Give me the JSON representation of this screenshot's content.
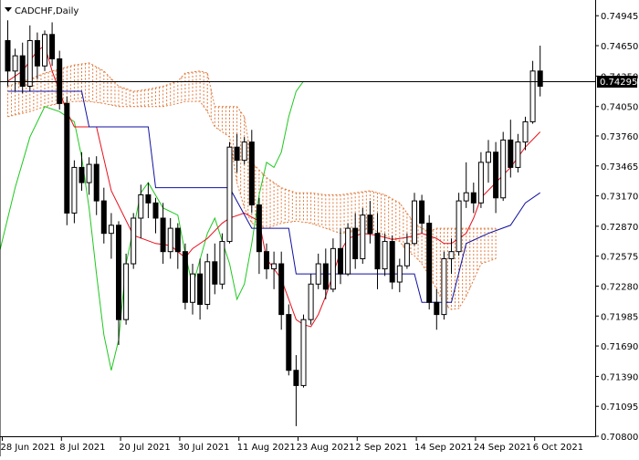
{
  "window": {
    "symbol_title": "CADCHF,Daily"
  },
  "price_box": {
    "label": "0.74295"
  },
  "colors": {
    "background": "#ffffff",
    "candle": "#000000",
    "tenkan": "#e8101b",
    "kijun": "#1010a0",
    "chikou": "#1ec81e",
    "kumo": "#e07a3c",
    "price_line": "#000000"
  },
  "chart_data": {
    "type": "candlestick",
    "title": "CADCHF,Daily",
    "indicator": "Ichimoku Kinko Hyo",
    "ylim": [
      0.708,
      0.751
    ],
    "y_ticks": [
      "0.74945",
      "0.74650",
      "0.74350",
      "0.74050",
      "0.73760",
      "0.73465",
      "0.73170",
      "0.72870",
      "0.72575",
      "0.72280",
      "0.71985",
      "0.71690",
      "0.71390",
      "0.71095",
      "0.70800"
    ],
    "x_ticks": [
      "28 Jun 2021",
      "8 Jul 2021",
      "20 Jul 2021",
      "30 Jul 2021",
      "11 Aug 2021",
      "23 Aug 2021",
      "2 Sep 2021",
      "14 Sep 2021",
      "24 Sep 2021",
      "6 Oct 2021"
    ],
    "x_tick_index": [
      0,
      8,
      16,
      24,
      32,
      40,
      48,
      56,
      64,
      72
    ],
    "current_price": 0.74295,
    "grid": false,
    "candles": [
      [
        0.747,
        0.749,
        0.7425,
        0.744
      ],
      [
        0.744,
        0.7462,
        0.742,
        0.7455
      ],
      [
        0.7455,
        0.7468,
        0.7418,
        0.7425
      ],
      [
        0.7425,
        0.7485,
        0.742,
        0.747
      ],
      [
        0.747,
        0.7478,
        0.7432,
        0.7445
      ],
      [
        0.7445,
        0.748,
        0.744,
        0.7476
      ],
      [
        0.7476,
        0.7488,
        0.7445,
        0.7452
      ],
      [
        0.7452,
        0.746,
        0.7402,
        0.7408
      ],
      [
        0.7408,
        0.7415,
        0.7288,
        0.73
      ],
      [
        0.73,
        0.7352,
        0.729,
        0.7345
      ],
      [
        0.7345,
        0.736,
        0.7322,
        0.733
      ],
      [
        0.733,
        0.7355,
        0.7318,
        0.7348
      ],
      [
        0.7348,
        0.7356,
        0.7298,
        0.7312
      ],
      [
        0.7312,
        0.7325,
        0.727,
        0.728
      ],
      [
        0.728,
        0.73,
        0.7255,
        0.7288
      ],
      [
        0.7288,
        0.7292,
        0.717,
        0.7195
      ],
      [
        0.7195,
        0.726,
        0.719,
        0.725
      ],
      [
        0.725,
        0.73,
        0.7245,
        0.7295
      ],
      [
        0.7295,
        0.7328,
        0.7275,
        0.7318
      ],
      [
        0.7318,
        0.733,
        0.7295,
        0.731
      ],
      [
        0.731,
        0.7315,
        0.728,
        0.7295
      ],
      [
        0.7295,
        0.731,
        0.725,
        0.7262
      ],
      [
        0.7262,
        0.7295,
        0.7255,
        0.7285
      ],
      [
        0.7285,
        0.729,
        0.7245,
        0.7262
      ],
      [
        0.7262,
        0.727,
        0.7205,
        0.7212
      ],
      [
        0.7212,
        0.725,
        0.72,
        0.724
      ],
      [
        0.724,
        0.7255,
        0.7195,
        0.721
      ],
      [
        0.721,
        0.726,
        0.7205,
        0.7252
      ],
      [
        0.7252,
        0.727,
        0.722,
        0.723
      ],
      [
        0.723,
        0.728,
        0.7225,
        0.7272
      ],
      [
        0.7272,
        0.737,
        0.727,
        0.7365
      ],
      [
        0.7365,
        0.7378,
        0.734,
        0.7352
      ],
      [
        0.7352,
        0.7375,
        0.7348,
        0.737
      ],
      [
        0.737,
        0.7382,
        0.73,
        0.7308
      ],
      [
        0.7308,
        0.7315,
        0.724,
        0.7262
      ],
      [
        0.7262,
        0.727,
        0.7235,
        0.7245
      ],
      [
        0.7245,
        0.7262,
        0.7225,
        0.725
      ],
      [
        0.725,
        0.7262,
        0.7185,
        0.72
      ],
      [
        0.72,
        0.721,
        0.714,
        0.7145
      ],
      [
        0.7145,
        0.716,
        0.709,
        0.713
      ],
      [
        0.713,
        0.72,
        0.7128,
        0.7195
      ],
      [
        0.7195,
        0.724,
        0.719,
        0.723
      ],
      [
        0.723,
        0.726,
        0.7225,
        0.725
      ],
      [
        0.725,
        0.7265,
        0.7215,
        0.7225
      ],
      [
        0.7225,
        0.7275,
        0.7222,
        0.7265
      ],
      [
        0.7265,
        0.7285,
        0.723,
        0.724
      ],
      [
        0.724,
        0.729,
        0.7238,
        0.7285
      ],
      [
        0.7285,
        0.73,
        0.7245,
        0.7255
      ],
      [
        0.7255,
        0.7305,
        0.725,
        0.7298
      ],
      [
        0.7298,
        0.7312,
        0.727,
        0.728
      ],
      [
        0.728,
        0.73,
        0.7225,
        0.7245
      ],
      [
        0.7245,
        0.728,
        0.7238,
        0.7272
      ],
      [
        0.7272,
        0.7278,
        0.7225,
        0.7232
      ],
      [
        0.7232,
        0.7255,
        0.7222,
        0.7248
      ],
      [
        0.7248,
        0.728,
        0.7245,
        0.727
      ],
      [
        0.727,
        0.732,
        0.7268,
        0.7312
      ],
      [
        0.7312,
        0.7318,
        0.728,
        0.729
      ],
      [
        0.729,
        0.7298,
        0.7205,
        0.7212
      ],
      [
        0.7212,
        0.7225,
        0.7185,
        0.72
      ],
      [
        0.72,
        0.7262,
        0.7195,
        0.7255
      ],
      [
        0.7255,
        0.7275,
        0.724,
        0.7262
      ],
      [
        0.7262,
        0.732,
        0.7258,
        0.7312
      ],
      [
        0.7312,
        0.735,
        0.7305,
        0.732
      ],
      [
        0.732,
        0.733,
        0.73,
        0.731
      ],
      [
        0.731,
        0.736,
        0.7305,
        0.735
      ],
      [
        0.735,
        0.7372,
        0.733,
        0.736
      ],
      [
        0.736,
        0.737,
        0.73,
        0.7315
      ],
      [
        0.7315,
        0.738,
        0.7312,
        0.7372
      ],
      [
        0.7372,
        0.7392,
        0.7335,
        0.7345
      ],
      [
        0.7345,
        0.7378,
        0.734,
        0.737
      ],
      [
        0.737,
        0.7395,
        0.7362,
        0.739
      ],
      [
        0.739,
        0.745,
        0.7388,
        0.744
      ],
      [
        0.744,
        0.7465,
        0.7415,
        0.7425
      ]
    ],
    "tenkan": [
      [
        0,
        0.743
      ],
      [
        2,
        0.744
      ],
      [
        4,
        0.746
      ],
      [
        5,
        0.7465
      ],
      [
        6,
        0.744
      ],
      [
        8,
        0.74
      ],
      [
        9,
        0.7385
      ],
      [
        12,
        0.7385
      ],
      [
        14,
        0.7322
      ],
      [
        17,
        0.7278
      ],
      [
        20,
        0.727
      ],
      [
        22,
        0.7268
      ],
      [
        23,
        0.7262
      ],
      [
        24,
        0.7256
      ],
      [
        25,
        0.7265
      ],
      [
        27,
        0.7275
      ],
      [
        29,
        0.729
      ],
      [
        30,
        0.7295
      ],
      [
        32,
        0.73
      ],
      [
        34,
        0.7292
      ],
      [
        35,
        0.7255
      ],
      [
        37,
        0.7235
      ],
      [
        38,
        0.7215
      ],
      [
        39,
        0.7195
      ],
      [
        40,
        0.719
      ],
      [
        41,
        0.7188
      ],
      [
        42,
        0.72
      ],
      [
        43,
        0.7218
      ],
      [
        44,
        0.724
      ],
      [
        45,
        0.7262
      ],
      [
        46,
        0.7275
      ],
      [
        48,
        0.728
      ],
      [
        50,
        0.7278
      ],
      [
        52,
        0.7274
      ],
      [
        54,
        0.7276
      ],
      [
        56,
        0.728
      ],
      [
        58,
        0.7275
      ],
      [
        59,
        0.727
      ],
      [
        60,
        0.727
      ],
      [
        62,
        0.728
      ],
      [
        63,
        0.7295
      ],
      [
        64,
        0.7315
      ],
      [
        66,
        0.733
      ],
      [
        68,
        0.7345
      ],
      [
        70,
        0.7365
      ],
      [
        72,
        0.738
      ]
    ],
    "kijun": [
      [
        0,
        0.742
      ],
      [
        10,
        0.742
      ],
      [
        11,
        0.7385
      ],
      [
        19,
        0.7385
      ],
      [
        20,
        0.7325
      ],
      [
        30,
        0.7325
      ],
      [
        33,
        0.7285
      ],
      [
        38,
        0.7285
      ],
      [
        39,
        0.724
      ],
      [
        55,
        0.724
      ],
      [
        56,
        0.7212
      ],
      [
        60,
        0.7212
      ],
      [
        62,
        0.727
      ],
      [
        65,
        0.728
      ],
      [
        68,
        0.7288
      ],
      [
        70,
        0.731
      ],
      [
        72,
        0.732
      ]
    ],
    "chikou": [
      [
        -3,
        0.7218
      ],
      [
        -1,
        0.7265
      ],
      [
        1,
        0.7325
      ],
      [
        3,
        0.7375
      ],
      [
        5,
        0.7405
      ],
      [
        7,
        0.74
      ],
      [
        9,
        0.739
      ],
      [
        10,
        0.7355
      ],
      [
        11,
        0.7305
      ],
      [
        12,
        0.724
      ],
      [
        13,
        0.718
      ],
      [
        14,
        0.7145
      ],
      [
        15,
        0.7175
      ],
      [
        16,
        0.725
      ],
      [
        18,
        0.732
      ],
      [
        19,
        0.733
      ],
      [
        21,
        0.7305
      ],
      [
        23,
        0.7298
      ],
      [
        24,
        0.726
      ],
      [
        25,
        0.7228
      ],
      [
        27,
        0.728
      ],
      [
        28,
        0.7295
      ],
      [
        30,
        0.725
      ],
      [
        31,
        0.7215
      ],
      [
        32,
        0.723
      ],
      [
        33,
        0.727
      ],
      [
        34,
        0.7318
      ],
      [
        35,
        0.735
      ],
      [
        36,
        0.7345
      ],
      [
        37,
        0.736
      ],
      [
        38,
        0.7395
      ],
      [
        39,
        0.742
      ],
      [
        40,
        0.743
      ]
    ],
    "kumo": [
      [
        0,
        0.7425,
        0.7395
      ],
      [
        3,
        0.7432,
        0.74
      ],
      [
        5,
        0.7438,
        0.7405
      ],
      [
        7,
        0.7442,
        0.7408
      ],
      [
        9,
        0.7446,
        0.741
      ],
      [
        11,
        0.7448,
        0.741
      ],
      [
        13,
        0.744,
        0.7408
      ],
      [
        15,
        0.7425,
        0.7405
      ],
      [
        17,
        0.742,
        0.7405
      ],
      [
        19,
        0.7422,
        0.7405
      ],
      [
        21,
        0.7425,
        0.7405
      ],
      [
        23,
        0.743,
        0.7408
      ],
      [
        24,
        0.7438,
        0.741
      ],
      [
        26,
        0.744,
        0.741
      ],
      [
        27,
        0.7438,
        0.74
      ],
      [
        28,
        0.7405,
        0.7385
      ],
      [
        30,
        0.7405,
        0.7375
      ],
      [
        31,
        0.7405,
        0.733
      ],
      [
        32,
        0.7395,
        0.7305
      ],
      [
        33,
        0.735,
        0.729
      ],
      [
        35,
        0.7335,
        0.7285
      ],
      [
        37,
        0.7325,
        0.729
      ],
      [
        39,
        0.732,
        0.7292
      ],
      [
        41,
        0.732,
        0.729
      ],
      [
        43,
        0.7318,
        0.7285
      ],
      [
        45,
        0.7318,
        0.728
      ],
      [
        47,
        0.732,
        0.7282
      ],
      [
        49,
        0.7322,
        0.7285
      ],
      [
        51,
        0.7318,
        0.7278
      ],
      [
        53,
        0.731,
        0.7272
      ],
      [
        54,
        0.73,
        0.7262
      ],
      [
        55,
        0.729,
        0.7258
      ],
      [
        56,
        0.7285,
        0.725
      ],
      [
        57,
        0.7282,
        0.7238
      ],
      [
        58,
        0.7285,
        0.7225
      ],
      [
        59,
        0.7285,
        0.721
      ],
      [
        60,
        0.7285,
        0.7205
      ],
      [
        61,
        0.7285,
        0.7206
      ],
      [
        62,
        0.7285,
        0.7218
      ],
      [
        64,
        0.7285,
        0.725
      ],
      [
        66,
        0.7285,
        0.7255
      ]
    ]
  }
}
